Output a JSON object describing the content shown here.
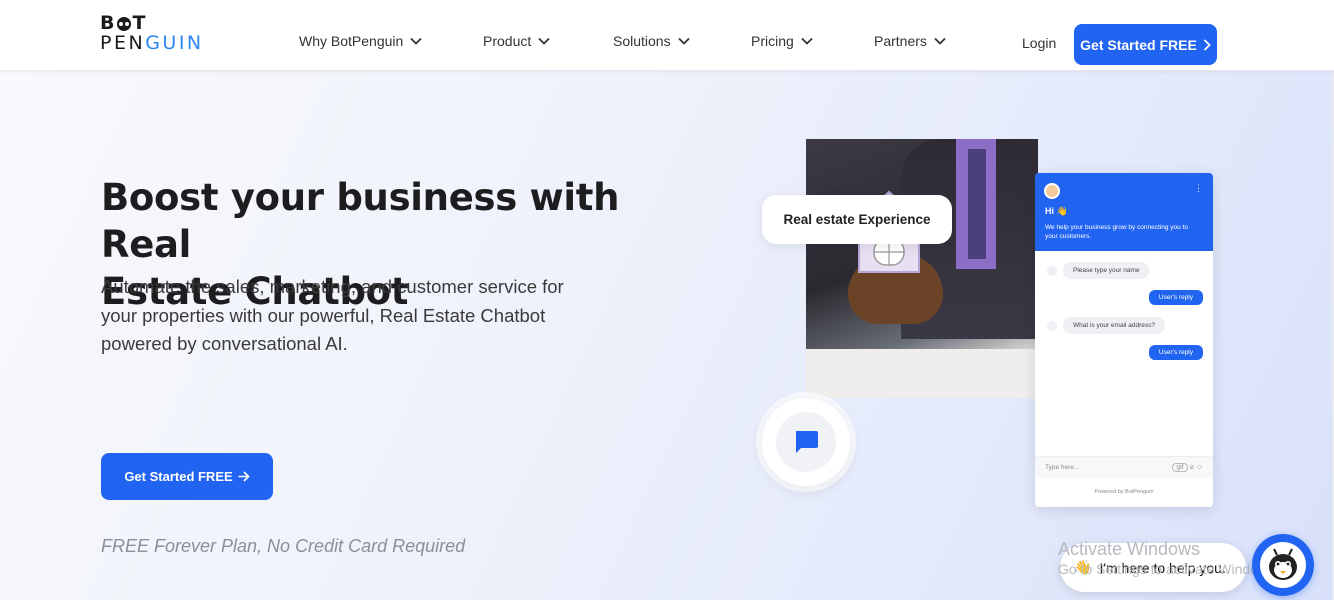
{
  "header": {
    "logo_top_left": "B",
    "logo_top_right": "T",
    "logo_bottom_dark": "PEN",
    "logo_bottom_blue": "GUIN",
    "nav": [
      {
        "label": "Why BotPenguin"
      },
      {
        "label": "Product"
      },
      {
        "label": "Solutions"
      },
      {
        "label": "Pricing"
      },
      {
        "label": "Partners"
      }
    ],
    "login": "Login",
    "cta": "Get Started FREE",
    "cta_icon": "chevron-right-icon"
  },
  "hero": {
    "title_line1": "Boost your business with Real",
    "title_line2": "Estate Chatbot",
    "subtitle": "Automate the sales, marketing, and customer service for your properties with our powerful, Real Estate Chatbot powered by conversational AI.",
    "cta": "Get Started FREE",
    "cta_icon": "arrow-right-icon",
    "note": "FREE Forever Plan, No Credit Card Required"
  },
  "illustration": {
    "badge": "Real estate Experience",
    "chat_icon": "message-icon"
  },
  "widget": {
    "menu": "⋮",
    "greeting": "Hi 👋",
    "description": "We help your business grow by connecting you to your customers.",
    "messages": [
      {
        "from": "bot",
        "text": "Please type your name"
      },
      {
        "from": "user",
        "text": "User's reply"
      },
      {
        "from": "bot",
        "text": "What is your email address?"
      },
      {
        "from": "user",
        "text": "User's reply"
      }
    ],
    "input_placeholder": "Type here...",
    "input_tag": "gif",
    "powered_by": "Powered by BotPenguin"
  },
  "overlay": {
    "activate_title": "Activate Windows",
    "activate_sub": "Go to Settings to activate Windows.",
    "help_text": "I'm here to help you.",
    "help_emoji": "👋"
  },
  "colors": {
    "brand_blue": "#2264f2",
    "logo_blue": "#2e86f5"
  }
}
